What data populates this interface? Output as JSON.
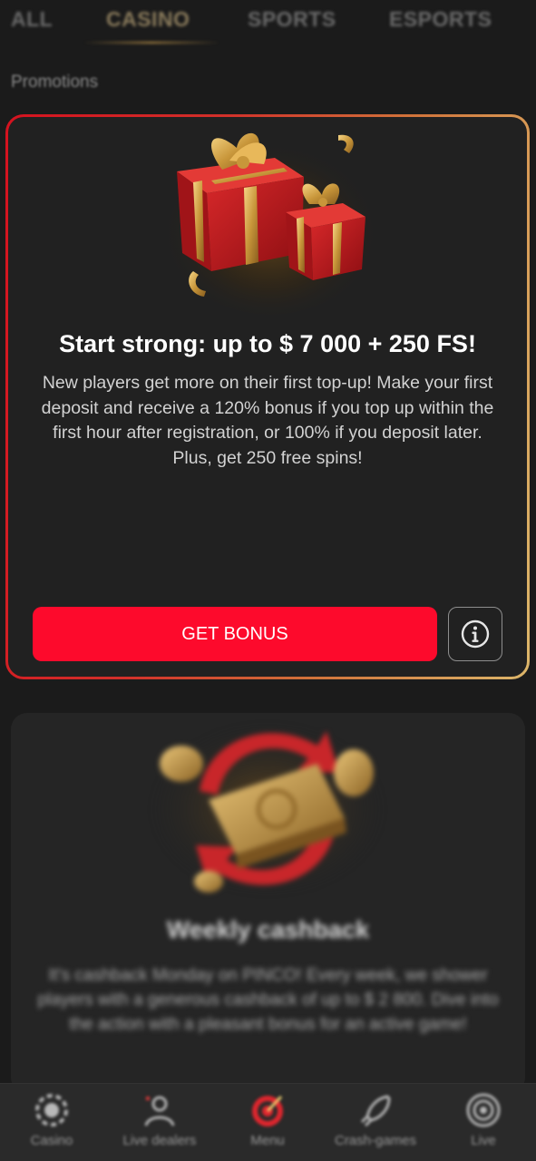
{
  "tabs": [
    {
      "label": "ALL",
      "active": false
    },
    {
      "label": "CASINO",
      "active": true
    },
    {
      "label": "SPORTS",
      "active": false
    },
    {
      "label": "ESPORTS",
      "active": false
    }
  ],
  "section_title": "Promotions",
  "promo_main": {
    "image_icon": "gift-boxes-icon",
    "title": "Start strong: up to $ 7 000 + 250 FS!",
    "description": "New players get more on their first top-up! Make your first deposit and receive a 120% bonus if you top up within the first hour after registration, or 100% if you deposit later. Plus, get 250 free spins!",
    "button_label": "GET BONUS",
    "info_icon": "info-icon"
  },
  "promo_second": {
    "image_icon": "cashback-coins-icon",
    "title": "Weekly cashback",
    "description": "It's cashback Monday on PINCO! Every week, we shower players with a generous cashback of up to $ 2 800. Dive into the action with a pleasant bonus for an active game!"
  },
  "bottom_nav": [
    {
      "label": "Casino",
      "icon": "chip-icon"
    },
    {
      "label": "Live dealers",
      "icon": "dealer-icon"
    },
    {
      "label": "Menu",
      "icon": "target-icon"
    },
    {
      "label": "Crash-games",
      "icon": "rocket-icon"
    },
    {
      "label": "Live",
      "icon": "live-icon"
    }
  ],
  "colors": {
    "background": "#1b1b1b",
    "card": "#212121",
    "accent_red": "#fd0a2c",
    "border_gold": "#dcb66a"
  }
}
